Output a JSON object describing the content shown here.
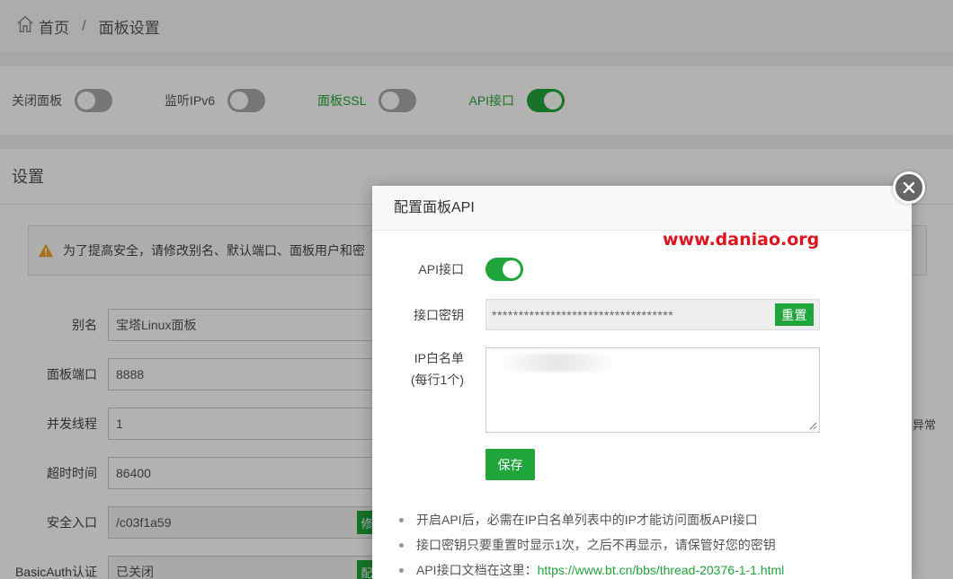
{
  "breadcrumb": {
    "home": "首页",
    "separator": "/",
    "current": "面板设置"
  },
  "toggles": [
    {
      "label": "关闭面板",
      "on": false,
      "highlight": false
    },
    {
      "label": "监听IPv6",
      "on": false,
      "highlight": false
    },
    {
      "label": "面板SSL",
      "on": false,
      "highlight": true
    },
    {
      "label": "API接口",
      "on": true,
      "highlight": true
    }
  ],
  "settings": {
    "title": "设置",
    "warning": "为了提高安全，请修改别名、默认端口、面板用户和密",
    "fields": [
      {
        "label": "别名",
        "value": "宝塔Linux面板"
      },
      {
        "label": "面板端口",
        "value": "8888"
      },
      {
        "label": "并发线程",
        "value": "1"
      },
      {
        "label": "超时时间",
        "value": "86400"
      },
      {
        "label": "安全入口",
        "value": "/c03f1a59",
        "button": "修"
      },
      {
        "label": "BasicAuth认证",
        "value": "已关闭",
        "button": "配"
      }
    ],
    "side_note": "异常"
  },
  "modal": {
    "title": "配置面板API",
    "watermark": "www.daniao.org",
    "api_label": "API接口",
    "api_on": true,
    "secret_label": "接口密钥",
    "secret_value": "**********************************",
    "reset_button": "重置",
    "ip_label_line1": "IP白名单",
    "ip_label_line2": "(每行1个)",
    "save_button": "保存",
    "notes": [
      {
        "text": "开启API后，必需在IP白名单列表中的IP才能访问面板API接口",
        "link": ""
      },
      {
        "text": "接口密钥只要重置时显示1次，之后不再显示，请保管好您的密钥",
        "link": ""
      },
      {
        "text": "API接口文档在这里：",
        "link": "https://www.bt.cn/bbs/thread-20376-1-1.html"
      }
    ]
  },
  "colors": {
    "accent": "#20a53a",
    "watermark": "#e0141e"
  }
}
